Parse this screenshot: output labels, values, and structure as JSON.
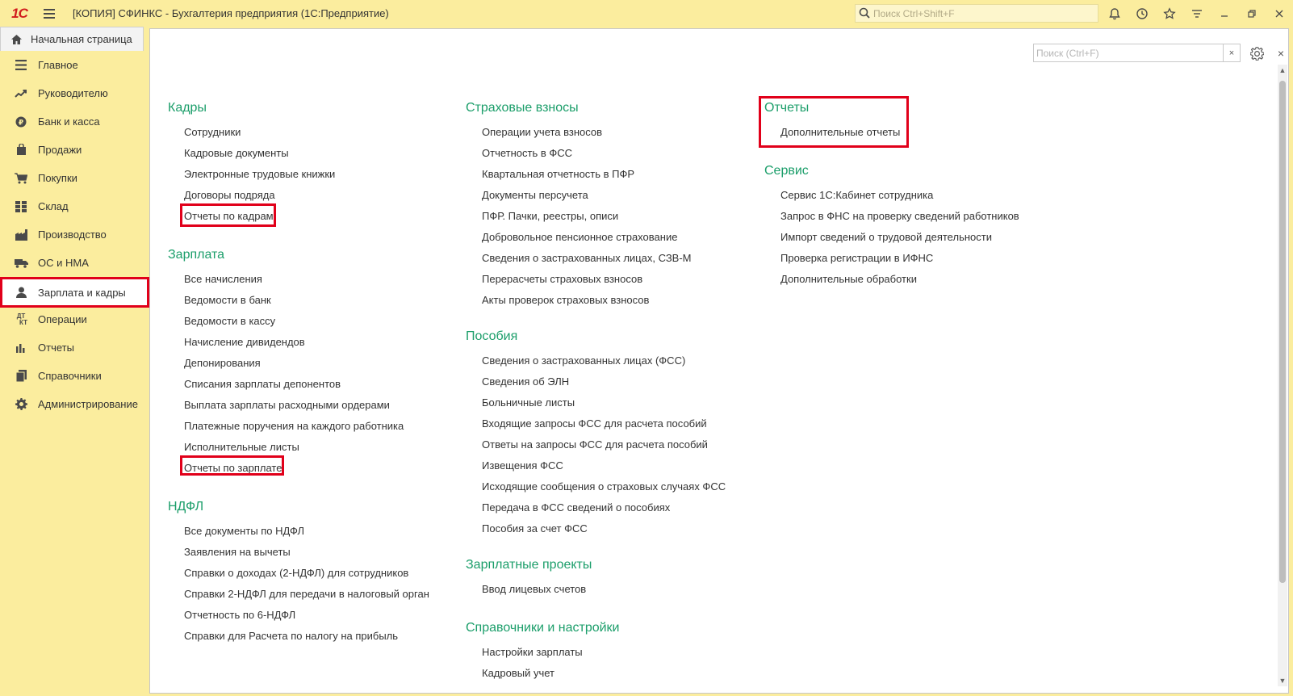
{
  "app": {
    "logo": "1С",
    "title": "[КОПИЯ] СФИНКС - Бухгалтерия предприятия  (1С:Предприятие)",
    "search_placeholder": "Поиск Ctrl+Shift+F"
  },
  "tabs": {
    "home_label": "Начальная страница"
  },
  "sidebar": {
    "items": [
      {
        "label": "Главное",
        "icon": "menu-lines-icon"
      },
      {
        "label": "Руководителю",
        "icon": "trend-icon"
      },
      {
        "label": "Банк и касса",
        "icon": "coin-icon"
      },
      {
        "label": "Продажи",
        "icon": "bag-icon"
      },
      {
        "label": "Покупки",
        "icon": "cart-icon"
      },
      {
        "label": "Склад",
        "icon": "warehouse-icon"
      },
      {
        "label": "Производство",
        "icon": "factory-icon"
      },
      {
        "label": "ОС и НМА",
        "icon": "truck-icon"
      },
      {
        "label": "Зарплата и кадры",
        "icon": "person-icon"
      },
      {
        "label": "Операции",
        "icon": "dt-kt-icon"
      },
      {
        "label": "Отчеты",
        "icon": "bar-chart-icon"
      },
      {
        "label": "Справочники",
        "icon": "books-icon"
      },
      {
        "label": "Администрирование",
        "icon": "gear-icon"
      }
    ],
    "active": "Зарплата и кадры"
  },
  "panel": {
    "search_placeholder": "Поиск (Ctrl+F)",
    "clear_label": "×",
    "close_label": "×"
  },
  "columns": {
    "kadry": {
      "title": "Кадры",
      "links": [
        "Сотрудники",
        "Кадровые документы",
        "Электронные трудовые книжки",
        "Договоры подряда",
        "Отчеты по кадрам"
      ]
    },
    "zarplata": {
      "title": "Зарплата",
      "links": [
        "Все начисления",
        "Ведомости в банк",
        "Ведомости в кассу",
        "Начисление дивидендов",
        "Депонирования",
        "Списания зарплаты депонентов",
        "Выплата зарплаты расходными ордерами",
        "Платежные поручения на каждого работника",
        "Исполнительные листы",
        "Отчеты по зарплате"
      ]
    },
    "ndfl": {
      "title": "НДФЛ",
      "links": [
        "Все документы по НДФЛ",
        "Заявления на вычеты",
        "Справки о доходах (2-НДФЛ) для сотрудников",
        "Справки 2-НДФЛ для передачи в налоговый орган",
        "Отчетность по 6-НДФЛ",
        "Справки для Расчета по налогу на прибыль"
      ]
    },
    "strah": {
      "title": "Страховые взносы",
      "links": [
        "Операции учета взносов",
        "Отчетность в ФСС",
        "Квартальная отчетность в ПФР",
        "Документы персучета",
        "ПФР. Пачки, реестры, описи",
        "Добровольное пенсионное страхование",
        "Сведения о застрахованных лицах, СЗВ-М",
        "Перерасчеты страховых взносов",
        "Акты проверок страховых взносов"
      ]
    },
    "posobiya": {
      "title": "Пособия",
      "links": [
        "Сведения о застрахованных лицах (ФСС)",
        "Сведения об ЭЛН",
        "Больничные листы",
        "Входящие запросы ФСС для расчета пособий",
        "Ответы на запросы ФСС для расчета пособий",
        "Извещения ФСС",
        "Исходящие сообщения о страховых случаях ФСС",
        "Передача в ФСС сведений о пособиях",
        "Пособия за счет ФСС"
      ]
    },
    "zp_proekty": {
      "title": "Зарплатные проекты",
      "links": [
        "Ввод лицевых счетов"
      ]
    },
    "spravochniki": {
      "title": "Справочники и настройки",
      "links": [
        "Настройки зарплаты",
        "Кадровый учет"
      ]
    },
    "otchety": {
      "title": "Отчеты",
      "links": [
        "Дополнительные отчеты"
      ]
    },
    "servis": {
      "title": "Сервис",
      "links": [
        "Сервис 1С:Кабинет сотрудника",
        "Запрос в ФНС на проверку сведений работников",
        "Импорт сведений о трудовой деятельности",
        "Проверка регистрации в ИФНС",
        "Дополнительные обработки"
      ]
    }
  },
  "colors": {
    "accent": "#1b9e6a",
    "highlight": "#e1001a",
    "chrome": "#fbed9e"
  }
}
